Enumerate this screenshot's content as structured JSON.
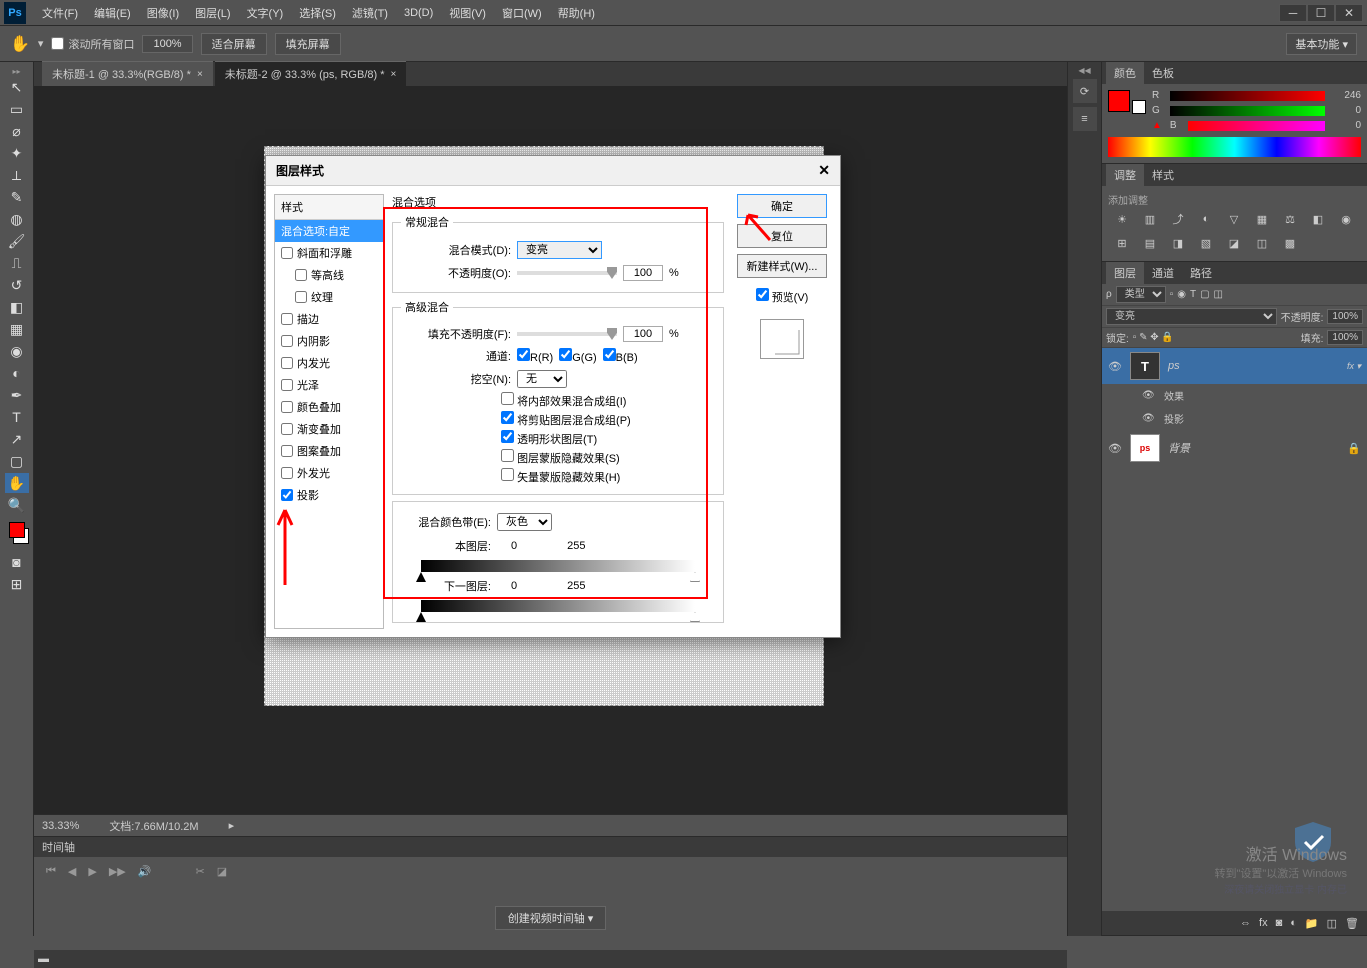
{
  "menubar": {
    "items": [
      "文件(F)",
      "编辑(E)",
      "图像(I)",
      "图层(L)",
      "文字(Y)",
      "选择(S)",
      "滤镜(T)",
      "3D(D)",
      "视图(V)",
      "窗口(W)",
      "帮助(H)"
    ]
  },
  "optionsbar": {
    "scroll_all": "滚动所有窗口",
    "zoom": "100%",
    "fit_screen": "适合屏幕",
    "fill_screen": "填充屏幕",
    "workspace": "基本功能"
  },
  "doc_tabs": [
    {
      "label": "未标题-1 @ 33.3%(RGB/8) *",
      "active": false
    },
    {
      "label": "未标题-2 @ 33.3% (ps, RGB/8) *",
      "active": true
    }
  ],
  "statusbar": {
    "zoom": "33.33%",
    "doc_info": "文档:7.66M/10.2M"
  },
  "timeline": {
    "tab": "时间轴",
    "create_btn": "创建视频时间轴"
  },
  "panels": {
    "color": {
      "tab1": "颜色",
      "tab2": "色板",
      "r": "R",
      "g": "G",
      "b": "B",
      "r_val": "246",
      "g_val": "0",
      "b_val": "0"
    },
    "adjust": {
      "tab1": "调整",
      "tab2": "样式",
      "hint": "添加调整"
    },
    "layers": {
      "tab1": "图层",
      "tab2": "通道",
      "tab3": "路径",
      "kind": "类型",
      "blend_mode": "变亮",
      "opacity_label": "不透明度:",
      "opacity": "100%",
      "lock_label": "锁定:",
      "fill_label": "填充:",
      "fill": "100%",
      "items": [
        {
          "name": "ps",
          "type": "T",
          "selected": true,
          "fx": true
        },
        {
          "name": "效果",
          "sub": true,
          "eff": true
        },
        {
          "name": "投影",
          "sub": true,
          "eff": true
        },
        {
          "name": "背景",
          "type": "ps",
          "locked": true
        }
      ]
    }
  },
  "dialog": {
    "title": "图层样式",
    "styles_header": "样式",
    "styles": [
      {
        "label": "混合选项:自定",
        "selected": true,
        "no_check": true
      },
      {
        "label": "斜面和浮雕"
      },
      {
        "label": "等高线",
        "indent": true
      },
      {
        "label": "纹理",
        "indent": true
      },
      {
        "label": "描边"
      },
      {
        "label": "内阴影"
      },
      {
        "label": "内发光"
      },
      {
        "label": "光泽"
      },
      {
        "label": "颜色叠加"
      },
      {
        "label": "渐变叠加"
      },
      {
        "label": "图案叠加"
      },
      {
        "label": "外发光"
      },
      {
        "label": "投影",
        "checked": true
      }
    ],
    "blend_options": "混合选项",
    "general": {
      "legend": "常规混合",
      "mode_label": "混合模式(D):",
      "mode_value": "变亮",
      "opacity_label": "不透明度(O):",
      "opacity_value": "100"
    },
    "advanced": {
      "legend": "高级混合",
      "fill_label": "填充不透明度(F):",
      "fill_value": "100",
      "channels_label": "通道:",
      "ch_r": "R(R)",
      "ch_g": "G(G)",
      "ch_b": "B(B)",
      "knockout_label": "挖空(N):",
      "knockout_value": "无",
      "opt1": "将内部效果混合成组(I)",
      "opt2": "将剪贴图层混合成组(P)",
      "opt3": "透明形状图层(T)",
      "opt4": "图层蒙版隐藏效果(S)",
      "opt5": "矢量蒙版隐藏效果(H)"
    },
    "blend_if": {
      "label": "混合颜色带(E):",
      "value": "灰色",
      "this_layer": "本图层:",
      "under_layer": "下一图层:",
      "v0": "0",
      "v255": "255"
    },
    "buttons": {
      "ok": "确定",
      "cancel": "复位",
      "new_style": "新建样式(W)...",
      "preview": "预览(V)"
    }
  },
  "watermark": {
    "line1": "激活 Windows",
    "line2": "转到\"设置\"以激活 Windows",
    "line3": "深夜请关闭独立显卡  内存已"
  }
}
